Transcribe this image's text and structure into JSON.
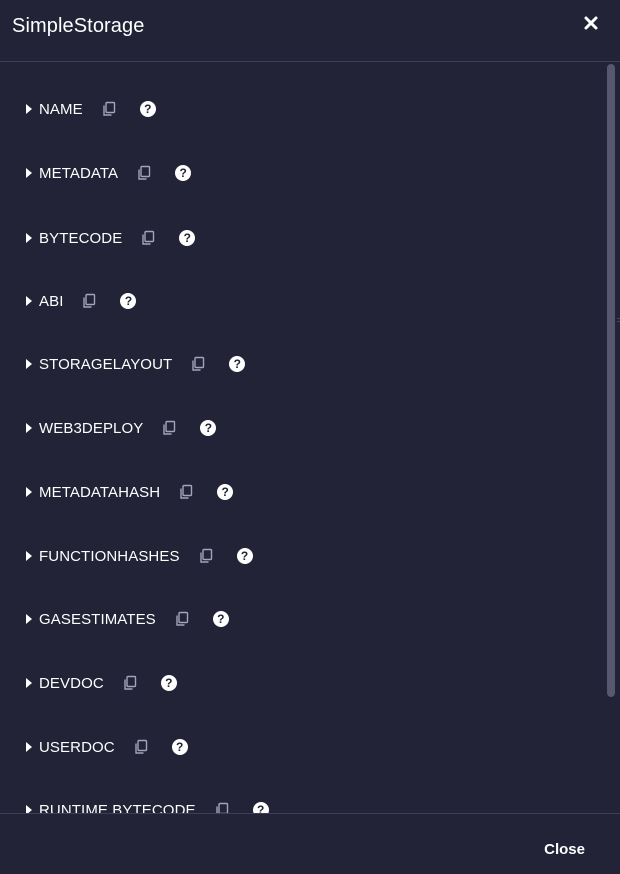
{
  "modal": {
    "title": "SimpleStorage",
    "close_x_icon": "close-icon",
    "footer_close_label": "Close"
  },
  "properties": [
    {
      "label": "NAME"
    },
    {
      "label": "METADATA"
    },
    {
      "label": "BYTECODE"
    },
    {
      "label": "ABI"
    },
    {
      "label": "STORAGELAYOUT"
    },
    {
      "label": "WEB3DEPLOY"
    },
    {
      "label": "METADATAHASH"
    },
    {
      "label": "FUNCTIONHASHES"
    },
    {
      "label": "GASESTIMATES"
    },
    {
      "label": "DEVDOC"
    },
    {
      "label": "USERDOC"
    },
    {
      "label": "RUNTIME BYTECODE"
    }
  ],
  "icons": {
    "caret": "caret-right-icon",
    "copy": "copy-icon",
    "help": "question-circle-icon",
    "help_glyph": "?"
  },
  "colors": {
    "background": "#222336",
    "text": "#ffffff",
    "icon_muted": "#a2a3bd",
    "divider": "#3d3f55",
    "scrollbar": "#56586f"
  }
}
